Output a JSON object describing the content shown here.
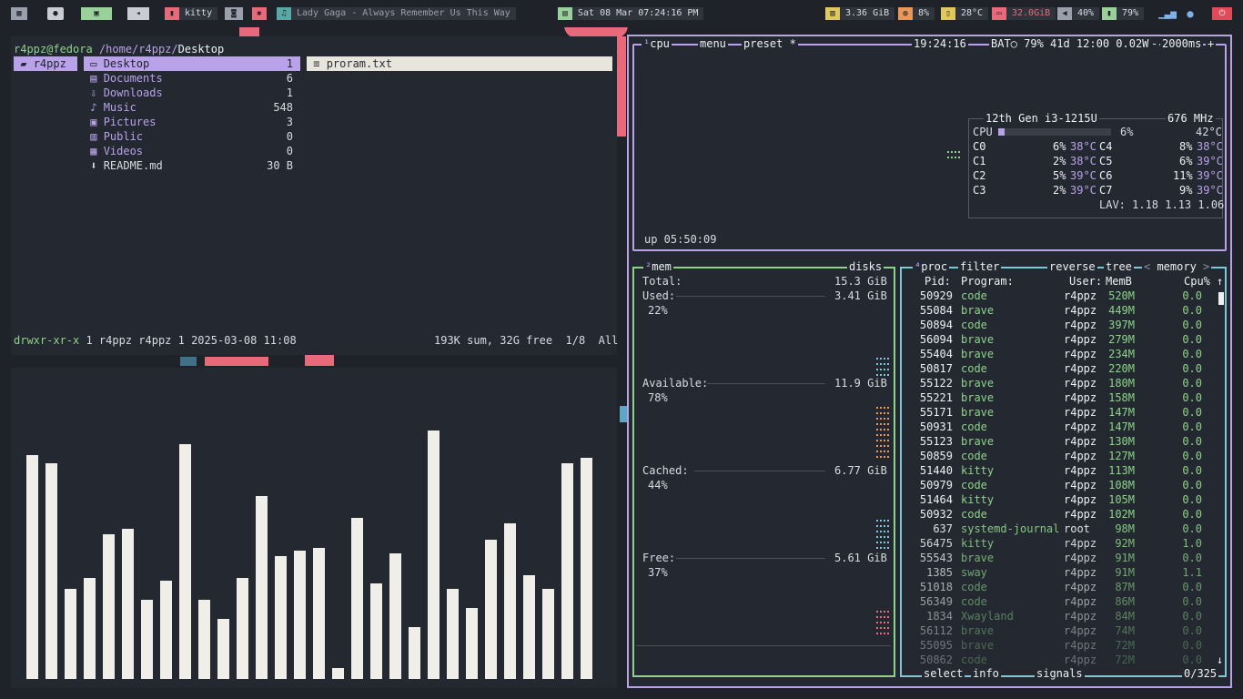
{
  "topbar": {
    "workspace1_icon": "grid-icon",
    "workspace2_icon": "github-icon",
    "workspace3_icon": "window-icon",
    "workspace4_icon": "back-icon",
    "window_title": "kitty",
    "now_playing": "Lady Gaga - Always Remember Us This Way",
    "clock": "Sat 08 Mar 07:24:16 PM",
    "memory": "3.36 GiB",
    "cpu": "8%",
    "temperature": "28°C",
    "disk": "32.0GiB",
    "volume": "40%",
    "battery": "79%"
  },
  "filemanager": {
    "prompt_user": "r4ppz@fedora",
    "prompt_path": "/home/r4ppz/",
    "prompt_dir": "Desktop",
    "left_column": "r4ppz",
    "entries": [
      {
        "name": "Desktop",
        "count": "1"
      },
      {
        "name": "Documents",
        "count": "6"
      },
      {
        "name": "Downloads",
        "count": "1"
      },
      {
        "name": "Music",
        "count": "548"
      },
      {
        "name": "Pictures",
        "count": "3"
      },
      {
        "name": "Public",
        "count": "0"
      },
      {
        "name": "Videos",
        "count": "0"
      },
      {
        "name": "README.md",
        "count": "30 B"
      }
    ],
    "preview_file": "proram.txt",
    "status_perms": "drwxr-xr-x",
    "status_meta": "1 r4ppz r4ppz 1 2025-03-08 11:08",
    "status_summary": "193K sum, 32G free",
    "status_pos": "1/8",
    "status_scope": "All"
  },
  "visualizer": {
    "levels": [
      0.82,
      0.79,
      0.33,
      0.37,
      0.53,
      0.55,
      0.29,
      0.36,
      0.86,
      0.29,
      0.22,
      0.37,
      0.67,
      0.45,
      0.47,
      0.48,
      0.04,
      0.59,
      0.35,
      0.46,
      0.19,
      0.91,
      0.33,
      0.26,
      0.51,
      0.57,
      0.38,
      0.33,
      0.79,
      0.81
    ]
  },
  "btop": {
    "cpu_title": "cpu",
    "menu_title": "menu",
    "preset_title": "preset *",
    "clock": "19:24:16",
    "battery_text": "BAT○ 79% 41d 12:00 0.02W",
    "interval": "2000ms",
    "plus_symbol": "+",
    "minus_symbol": "-",
    "cpu_model": "12th Gen i3-1215U",
    "cpu_freq": "676 MHz",
    "cpu_total_label": "CPU",
    "cpu_total_pct": "6%",
    "cpu_total_temp": "42°C",
    "cpu_total_level": 0.06,
    "cores": [
      {
        "name": "C0",
        "pct": "6%",
        "temp": "38°C"
      },
      {
        "name": "C1",
        "pct": "2%",
        "temp": "38°C"
      },
      {
        "name": "C2",
        "pct": "5%",
        "temp": "39°C"
      },
      {
        "name": "C3",
        "pct": "2%",
        "temp": "39°C"
      },
      {
        "name": "C4",
        "pct": "8%",
        "temp": "38°C"
      },
      {
        "name": "C5",
        "pct": "6%",
        "temp": "39°C"
      },
      {
        "name": "C6",
        "pct": "11%",
        "temp": "39°C"
      },
      {
        "name": "C7",
        "pct": "9%",
        "temp": "39°C"
      }
    ],
    "lav": "LAV: 1.18 1.13 1.06",
    "uptime": "up 05:50:09",
    "mem_title": "mem",
    "disks_title": "disks",
    "mem": {
      "total_label": "Total:",
      "total": "15.3 GiB",
      "used_label": "Used:",
      "used": "3.41 GiB",
      "used_pct": "22%",
      "avail_label": "Available:",
      "avail": "11.9 GiB",
      "avail_pct": "78%",
      "cached_label": "Cached:",
      "cached": "6.77 GiB",
      "cached_pct": "44%",
      "free_label": "Free:",
      "free": "5.61 GiB",
      "free_pct": "37%"
    },
    "proc_tabs": {
      "proc": "proc",
      "filter": "filter",
      "reverse": "reverse",
      "tree": "tree",
      "memory": "memory"
    },
    "proc_headers": {
      "pid": "Pid:",
      "program": "Program:",
      "user": "User:",
      "mem": "MemB",
      "cpu": "Cpu%"
    },
    "processes": [
      {
        "pid": "50929",
        "program": "code",
        "user": "r4ppz",
        "mem": "520M",
        "cpu": "0.0"
      },
      {
        "pid": "55084",
        "program": "brave",
        "user": "r4ppz",
        "mem": "449M",
        "cpu": "0.0"
      },
      {
        "pid": "50894",
        "program": "code",
        "user": "r4ppz",
        "mem": "397M",
        "cpu": "0.0"
      },
      {
        "pid": "56094",
        "program": "brave",
        "user": "r4ppz",
        "mem": "279M",
        "cpu": "0.0"
      },
      {
        "pid": "55404",
        "program": "brave",
        "user": "r4ppz",
        "mem": "234M",
        "cpu": "0.0"
      },
      {
        "pid": "50817",
        "program": "code",
        "user": "r4ppz",
        "mem": "220M",
        "cpu": "0.0"
      },
      {
        "pid": "55122",
        "program": "brave",
        "user": "r4ppz",
        "mem": "180M",
        "cpu": "0.0"
      },
      {
        "pid": "55221",
        "program": "brave",
        "user": "r4ppz",
        "mem": "158M",
        "cpu": "0.0"
      },
      {
        "pid": "55171",
        "program": "brave",
        "user": "r4ppz",
        "mem": "147M",
        "cpu": "0.0"
      },
      {
        "pid": "50931",
        "program": "code",
        "user": "r4ppz",
        "mem": "147M",
        "cpu": "0.0"
      },
      {
        "pid": "55123",
        "program": "brave",
        "user": "r4ppz",
        "mem": "130M",
        "cpu": "0.0"
      },
      {
        "pid": "50859",
        "program": "code",
        "user": "r4ppz",
        "mem": "127M",
        "cpu": "0.0"
      },
      {
        "pid": "51440",
        "program": "kitty",
        "user": "r4ppz",
        "mem": "113M",
        "cpu": "0.0"
      },
      {
        "pid": "50979",
        "program": "code",
        "user": "r4ppz",
        "mem": "108M",
        "cpu": "0.0"
      },
      {
        "pid": "51464",
        "program": "kitty",
        "user": "r4ppz",
        "mem": "105M",
        "cpu": "0.0"
      },
      {
        "pid": "50932",
        "program": "code",
        "user": "r4ppz",
        "mem": "102M",
        "cpu": "0.0"
      },
      {
        "pid": "637",
        "program": "systemd-journal",
        "user": "root",
        "mem": "98M",
        "cpu": "0.0"
      },
      {
        "pid": "56475",
        "program": "kitty",
        "user": "r4ppz",
        "mem": "92M",
        "cpu": "1.0"
      },
      {
        "pid": "55543",
        "program": "brave",
        "user": "r4ppz",
        "mem": "91M",
        "cpu": "0.0"
      },
      {
        "pid": "1385",
        "program": "sway",
        "user": "r4ppz",
        "mem": "91M",
        "cpu": "1.1"
      },
      {
        "pid": "51018",
        "program": "code",
        "user": "r4ppz",
        "mem": "87M",
        "cpu": "0.0"
      },
      {
        "pid": "56349",
        "program": "code",
        "user": "r4ppz",
        "mem": "86M",
        "cpu": "0.0"
      },
      {
        "pid": "1834",
        "program": "Xwayland",
        "user": "r4ppz",
        "mem": "84M",
        "cpu": "0.0"
      },
      {
        "pid": "56112",
        "program": "brave",
        "user": "r4ppz",
        "mem": "74M",
        "cpu": "0.0"
      },
      {
        "pid": "55095",
        "program": "brave",
        "user": "r4ppz",
        "mem": "72M",
        "cpu": "0.0"
      },
      {
        "pid": "50862",
        "program": "code",
        "user": "r4ppz",
        "mem": "72M",
        "cpu": "0.0"
      }
    ],
    "footer_select": "select",
    "footer_info": "info",
    "footer_signals": "signals",
    "footer_count": "0/325"
  },
  "colors": {
    "accent": "#b9a2e8",
    "green": "#8ed38a",
    "cyan": "#7fc8d8",
    "pink": "#e86a7a"
  }
}
